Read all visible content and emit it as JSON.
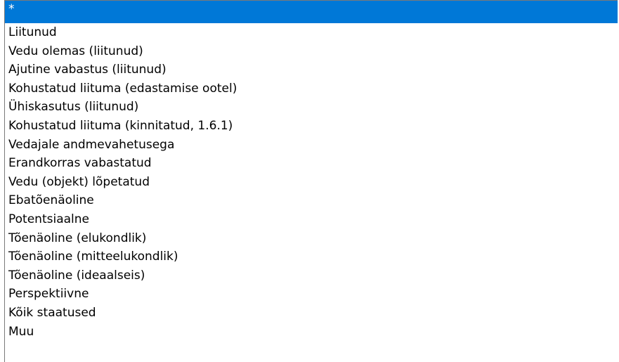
{
  "dropdown": {
    "selected_index": 0,
    "options": [
      {
        "label": "*"
      },
      {
        "label": "Liitunud"
      },
      {
        "label": "Vedu olemas (liitunud)"
      },
      {
        "label": "Ajutine vabastus (liitunud)"
      },
      {
        "label": "Kohustatud liituma (edastamise ootel)"
      },
      {
        "label": "Ühiskasutus (liitunud)"
      },
      {
        "label": "Kohustatud liituma (kinnitatud, 1.6.1)"
      },
      {
        "label": "Vedajale andmevahetusega"
      },
      {
        "label": "Erandkorras vabastatud"
      },
      {
        "label": "Vedu (objekt) lõpetatud"
      },
      {
        "label": "Ebatõenäoline"
      },
      {
        "label": "Potentsiaalne"
      },
      {
        "label": "Tõenäoline (elukondlik)"
      },
      {
        "label": "Tõenäoline (mitteelukondlik)"
      },
      {
        "label": "Tõenäoline (ideaalseis)"
      },
      {
        "label": "Perspektiivne"
      },
      {
        "label": "Kõik staatused"
      },
      {
        "label": "Muu"
      }
    ],
    "colors": {
      "selected_background": "#0078d7",
      "selected_text": "#ffffff",
      "text": "#000000",
      "border": "#7a7a7a"
    }
  }
}
